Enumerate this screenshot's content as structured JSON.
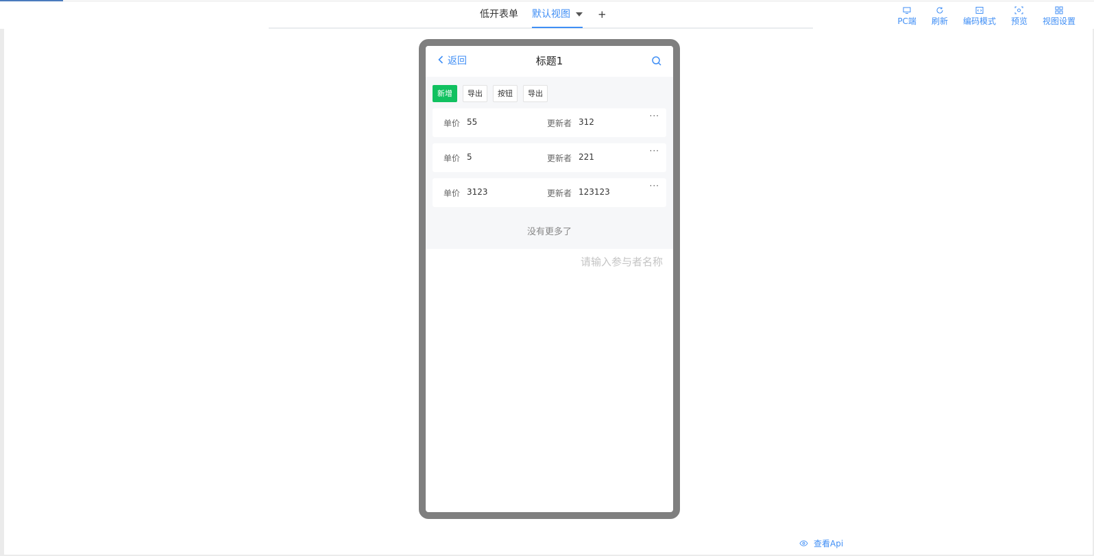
{
  "header": {
    "tabs": [
      {
        "label": "低开表单"
      },
      {
        "label": "默认视图"
      },
      {
        "label": "+"
      }
    ],
    "toolbar": [
      {
        "label": "PC端",
        "icon": "monitor-icon"
      },
      {
        "label": "刷新",
        "icon": "refresh-icon"
      },
      {
        "label": "编码模式",
        "icon": "code-icon"
      },
      {
        "label": "预览",
        "icon": "preview-icon"
      },
      {
        "label": "视图设置",
        "icon": "grid-icon"
      }
    ]
  },
  "phone": {
    "back_label": "返回",
    "title": "标题1",
    "buttons": [
      {
        "label": "新增"
      },
      {
        "label": "导出"
      },
      {
        "label": "按钮"
      },
      {
        "label": "导出"
      }
    ],
    "records": [
      {
        "price_label": "单价",
        "price": "55",
        "updater_label": "更新者",
        "updater": "312",
        "more": "···"
      },
      {
        "price_label": "单价",
        "price": "5",
        "updater_label": "更新者",
        "updater": "221",
        "more": "···"
      },
      {
        "price_label": "单价",
        "price": "3123",
        "updater_label": "更新者",
        "updater": "123123",
        "more": "···"
      }
    ],
    "no_more": "没有更多了",
    "placeholder": "请输入参与者名称"
  },
  "footer": {
    "view_api": "查看Api"
  },
  "colors": {
    "accent": "#3f8ef5",
    "primary_button": "#11c160",
    "phone_frame": "#7f7f7f"
  }
}
